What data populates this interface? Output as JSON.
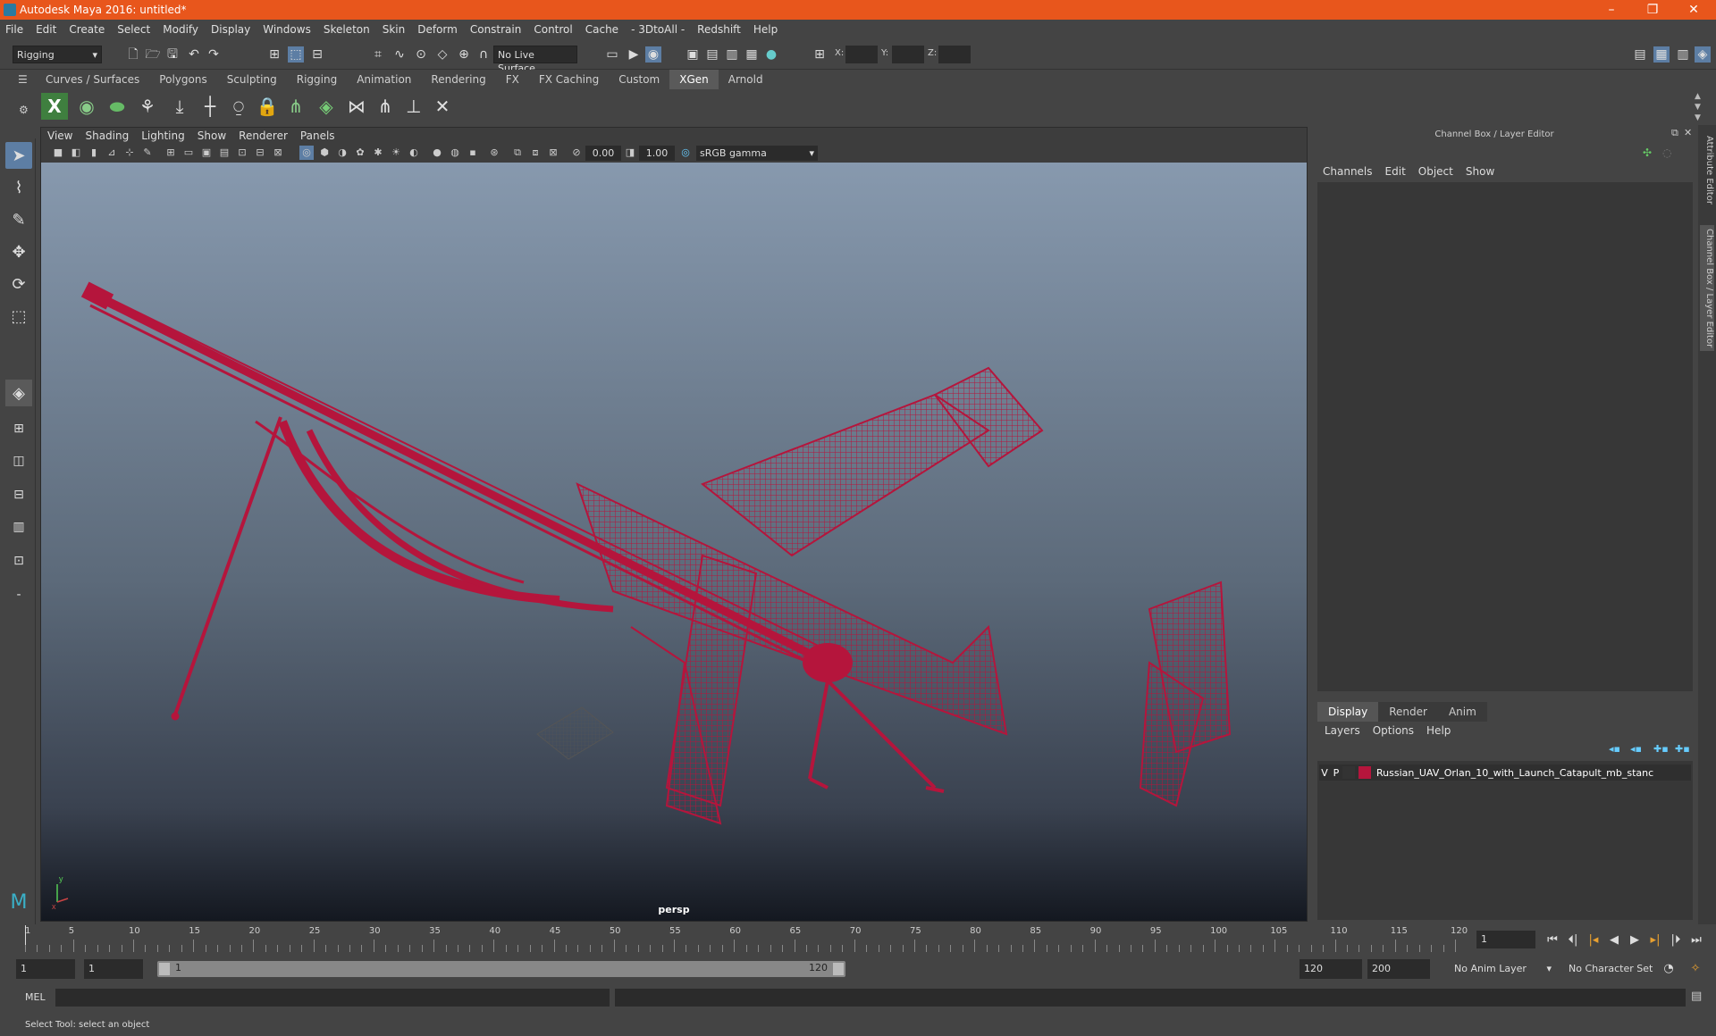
{
  "window": {
    "title": "Autodesk Maya 2016: untitled*",
    "minimize": "–",
    "restore": "❐",
    "close": "✕"
  },
  "menubar": [
    "File",
    "Edit",
    "Create",
    "Select",
    "Modify",
    "Display",
    "Windows",
    "Skeleton",
    "Skin",
    "Deform",
    "Constrain",
    "Control",
    "Cache",
    "- 3DtoAll -",
    "Redshift",
    "Help"
  ],
  "statusline": {
    "menuset": "Rigging",
    "live_surface": "No Live Surface",
    "x_label": "X:",
    "y_label": "Y:",
    "z_label": "Z:"
  },
  "shelf_tabs": [
    "Curves / Surfaces",
    "Polygons",
    "Sculpting",
    "Rigging",
    "Animation",
    "Rendering",
    "FX",
    "FX Caching",
    "Custom",
    "XGen",
    "Arnold"
  ],
  "active_shelf_tab": "XGen",
  "viewport": {
    "menu": [
      "View",
      "Shading",
      "Lighting",
      "Show",
      "Renderer",
      "Panels"
    ],
    "exposure": "0.00",
    "gamma": "1.00",
    "color_space": "sRGB gamma",
    "camera": "persp",
    "axis_y": "y",
    "axis_x": "x",
    "wire_color": "#b5153c"
  },
  "channel_box": {
    "title": "Channel Box / Layer Editor",
    "menu": [
      "Channels",
      "Edit",
      "Object",
      "Show"
    ]
  },
  "layer_editor": {
    "tabs": [
      "Display",
      "Render",
      "Anim"
    ],
    "active_tab": "Display",
    "menu": [
      "Layers",
      "Options",
      "Help"
    ],
    "layers": [
      {
        "v": "V",
        "p": "P",
        "color": "#b5153c",
        "name": "Russian_UAV_Orlan_10_with_Launch_Catapult_mb_stanc"
      }
    ]
  },
  "side_tabs": [
    "Attribute Editor",
    "Channel Box / Layer Editor"
  ],
  "timeline": {
    "start_label": "1",
    "ticks": [
      "5",
      "10",
      "15",
      "20",
      "25",
      "30",
      "35",
      "40",
      "45",
      "50",
      "55",
      "60",
      "65",
      "70",
      "75",
      "80",
      "85",
      "90",
      "95",
      "100",
      "105",
      "110",
      "115",
      "120"
    ],
    "current_frame": "1"
  },
  "range": {
    "start": "1",
    "playback_start": "1",
    "slider_start": "1",
    "slider_end": "120",
    "playback_end": "120",
    "end": "200",
    "anim_layer": "No Anim Layer",
    "character_set": "No Character Set"
  },
  "command_line": {
    "label": "MEL"
  },
  "help_line": "Select Tool: select an object"
}
